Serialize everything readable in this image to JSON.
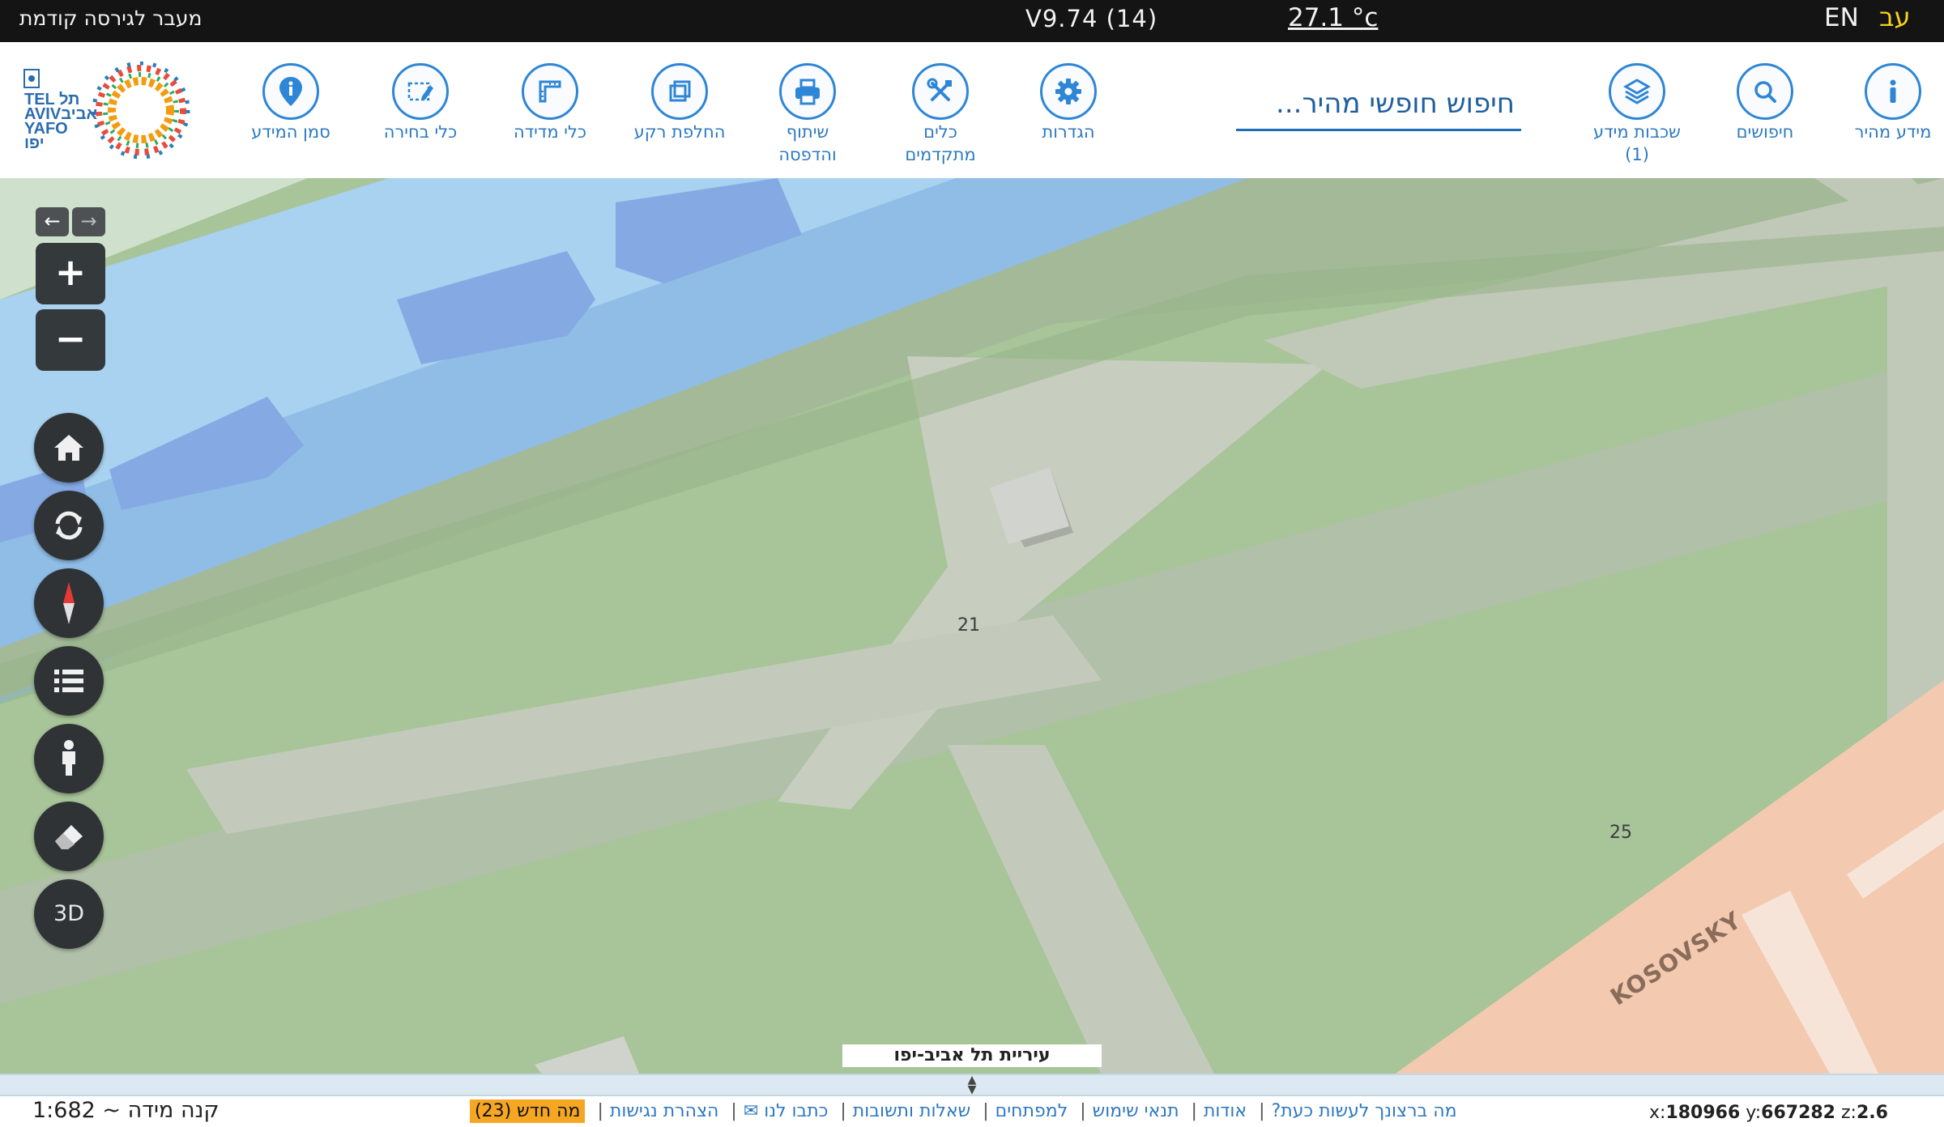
{
  "topbar": {
    "previous_version_link": "מעבר לגירסה קודמת",
    "version": "V9.74 (14)",
    "temperature": "27.1 °c",
    "lang_en": "EN",
    "lang_he": "עב"
  },
  "toolbar": {
    "search_placeholder": "חיפוש חופשי מהיר...",
    "items": [
      {
        "label": "מידע מהיר",
        "icon": "info-icon"
      },
      {
        "label": "חיפושים",
        "icon": "search-icon"
      },
      {
        "label": "שכבות מידע",
        "sub": "(1)",
        "icon": "layers-icon"
      },
      {
        "label": "הגדרות",
        "icon": "gear-icon"
      },
      {
        "label": "כלים",
        "sub": "מתקדמים",
        "icon": "tools-icon"
      },
      {
        "label": "שיתוף",
        "sub": "והדפסה",
        "icon": "printer-icon"
      },
      {
        "label": "החלפת רקע",
        "icon": "background-switch-icon"
      },
      {
        "label": "כלי מדידה",
        "icon": "ruler-icon"
      },
      {
        "label": "כלי בחירה",
        "icon": "select-icon"
      },
      {
        "label": "סמן המידע",
        "icon": "info-marker-icon"
      }
    ],
    "logo_text": {
      "line1": "TEL",
      "line2": "AVIV",
      "line3": "YAFO",
      "he1": "תל",
      "he2": "אביב",
      "he3": "יפו"
    }
  },
  "map": {
    "labels": {
      "parcel_21": "21",
      "parcel_25": "25",
      "street": "KOSOVSKY"
    },
    "attribution": "עיריית תל אביב-יפו",
    "controls": {
      "back": "←",
      "forward": "→",
      "zoom_in": "+",
      "zoom_out": "−",
      "mode_3d": "3D"
    }
  },
  "footer": {
    "scale": "1:682 ~ קנה מידה",
    "links": [
      "מה ברצונך לעשות כעת?",
      "אודות",
      "תנאי שימוש",
      "למפתחים",
      "שאלות ותשובות",
      "כתבו לנו ✉",
      "הצהרת נגישות"
    ],
    "whats_new": "מה חדש (23)",
    "coords": {
      "x_label": "x:",
      "x": "180966",
      "y_label": "y:",
      "y": "667282",
      "z_label": "z:",
      "z": "2.6"
    }
  }
}
